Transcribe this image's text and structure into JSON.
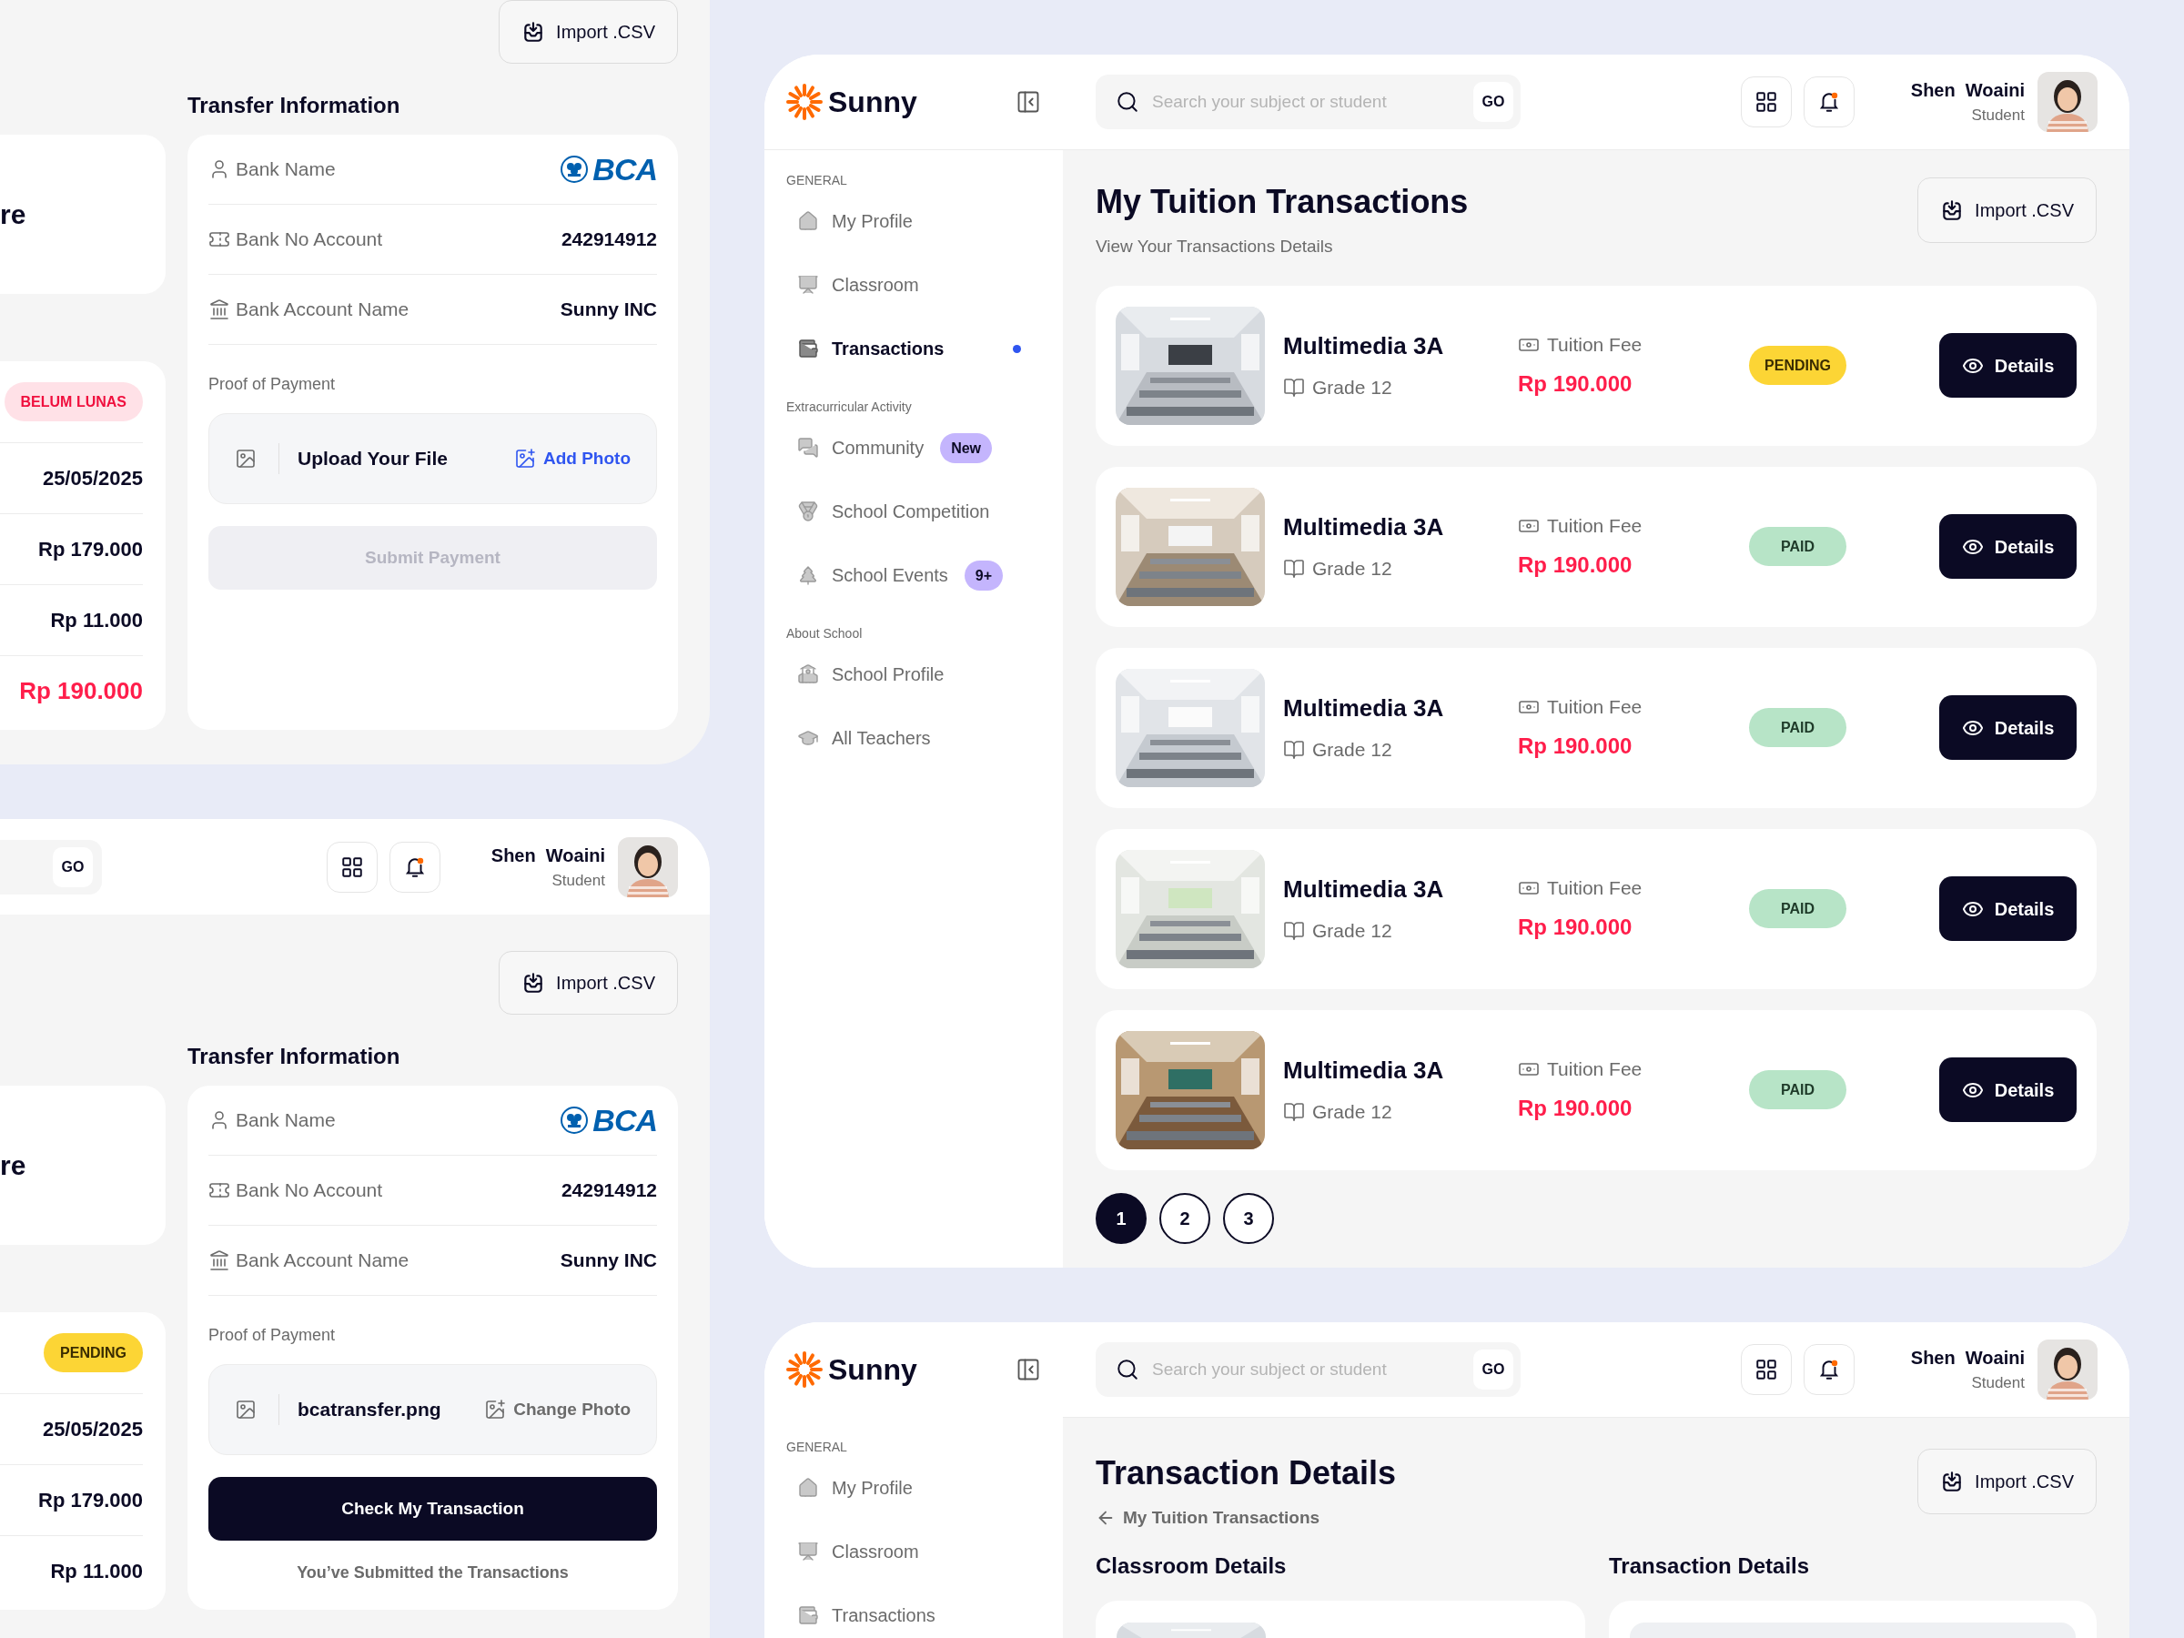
{
  "payment_screens": [
    {
      "import_label": "Import .CSV",
      "summary_fragment": "re",
      "status": {
        "label": "BELUM LUNAS",
        "kind": "unpaid"
      },
      "summary_values": [
        {
          "text": "25/05/2025",
          "kind": "value"
        },
        {
          "text": "Rp 179.000",
          "kind": "value"
        },
        {
          "text": "Rp 11.000",
          "kind": "value"
        },
        {
          "text": "Rp 190.000",
          "kind": "total"
        }
      ],
      "transfer_title": "Transfer Information",
      "transfer_rows": [
        {
          "label": "Bank Name",
          "value": "BCA",
          "kind": "logo"
        },
        {
          "label": "Bank No Account",
          "value": "242914912",
          "kind": "text"
        },
        {
          "label": "Bank Account Name",
          "value": "Sunny INC",
          "kind": "text"
        }
      ],
      "proof_label": "Proof of Payment",
      "upload": {
        "file": "Upload Your File",
        "action": "Add Photo",
        "uploaded": false
      },
      "submit": {
        "label": "Submit Payment",
        "disabled": true
      }
    },
    {
      "header": {
        "go_label": "GO",
        "user": {
          "name": "Shen  Woaini",
          "role": "Student"
        }
      },
      "import_label": "Import .CSV",
      "summary_fragment": "re",
      "status": {
        "label": "PENDING",
        "kind": "pending"
      },
      "summary_values": [
        {
          "text": "25/05/2025",
          "kind": "value"
        },
        {
          "text": "Rp 179.000",
          "kind": "value"
        },
        {
          "text": "Rp 11.000",
          "kind": "value"
        }
      ],
      "transfer_title": "Transfer Information",
      "transfer_rows": [
        {
          "label": "Bank Name",
          "value": "BCA",
          "kind": "logo"
        },
        {
          "label": "Bank No Account",
          "value": "242914912",
          "kind": "text"
        },
        {
          "label": "Bank Account Name",
          "value": "Sunny INC",
          "kind": "text"
        }
      ],
      "proof_label": "Proof of Payment",
      "upload": {
        "file": "bcatransfer.png",
        "action": "Change Photo",
        "uploaded": true
      },
      "submit": {
        "label": "Check My Transaction",
        "disabled": false
      },
      "note": "You’ve Submitted the Transactions"
    }
  ],
  "transactions_screen": {
    "header": {
      "brand": "Sunny",
      "search_placeholder": "Search your subject or student",
      "go_label": "GO",
      "user": {
        "name": "Shen  Woaini",
        "role": "Student"
      }
    },
    "sidebar": [
      {
        "heading": "GENERAL",
        "items": [
          {
            "label": "My Profile",
            "kind": "home",
            "selected": false
          },
          {
            "label": "Classroom",
            "kind": "board",
            "selected": false
          },
          {
            "label": "Transactions",
            "kind": "wallet",
            "selected": true
          }
        ]
      },
      {
        "heading": "Extracurricular Activity",
        "items": [
          {
            "label": "Community",
            "kind": "chat",
            "selected": false,
            "badge": "New"
          },
          {
            "label": "School Competition",
            "kind": "medal",
            "selected": false
          },
          {
            "label": "School Events",
            "kind": "tree",
            "selected": false,
            "badge": "9+"
          }
        ]
      },
      {
        "heading": "About School",
        "items": [
          {
            "label": "School Profile",
            "kind": "school",
            "selected": false
          },
          {
            "label": "All Teachers",
            "kind": "cap",
            "selected": false
          }
        ]
      }
    ],
    "title": "My Tuition Transactions",
    "subtitle": "View Your Transactions Details",
    "import_label": "Import .CSV",
    "transactions": [
      {
        "class_name": "Multimedia 3A",
        "grade": "Grade 12",
        "fee_label": "Tuition Fee",
        "amount": "Rp 190.000",
        "status": {
          "label": "PENDING",
          "kind": "pending"
        },
        "action": "Details"
      },
      {
        "class_name": "Multimedia 3A",
        "grade": "Grade 12",
        "fee_label": "Tuition Fee",
        "amount": "Rp 190.000",
        "status": {
          "label": "PAID",
          "kind": "paid"
        },
        "action": "Details"
      },
      {
        "class_name": "Multimedia 3A",
        "grade": "Grade 12",
        "fee_label": "Tuition Fee",
        "amount": "Rp 190.000",
        "status": {
          "label": "PAID",
          "kind": "paid"
        },
        "action": "Details"
      },
      {
        "class_name": "Multimedia 3A",
        "grade": "Grade 12",
        "fee_label": "Tuition Fee",
        "amount": "Rp 190.000",
        "status": {
          "label": "PAID",
          "kind": "paid"
        },
        "action": "Details"
      },
      {
        "class_name": "Multimedia 3A",
        "grade": "Grade 12",
        "fee_label": "Tuition Fee",
        "amount": "Rp 190.000",
        "status": {
          "label": "PAID",
          "kind": "paid"
        },
        "action": "Details"
      }
    ],
    "pagination": [
      {
        "label": "1",
        "selected": true
      },
      {
        "label": "2",
        "selected": false
      },
      {
        "label": "3",
        "selected": false
      }
    ]
  },
  "details_screen": {
    "header": {
      "brand": "Sunny",
      "search_placeholder": "Search your subject or student",
      "go_label": "GO",
      "user": {
        "name": "Shen  Woaini",
        "role": "Student"
      }
    },
    "sidebar": [
      {
        "heading": "GENERAL",
        "items": [
          {
            "label": "My Profile",
            "kind": "home",
            "selected": false
          },
          {
            "label": "Classroom",
            "kind": "board",
            "selected": false
          },
          {
            "label": "Transactions",
            "kind": "wallet",
            "selected": false
          }
        ]
      }
    ],
    "title": "Transaction Details",
    "back_link": "My Tuition Transactions",
    "import_label": "Import .CSV",
    "sections": [
      {
        "title": "Classroom Details"
      },
      {
        "title": "Transaction Details"
      }
    ]
  }
}
